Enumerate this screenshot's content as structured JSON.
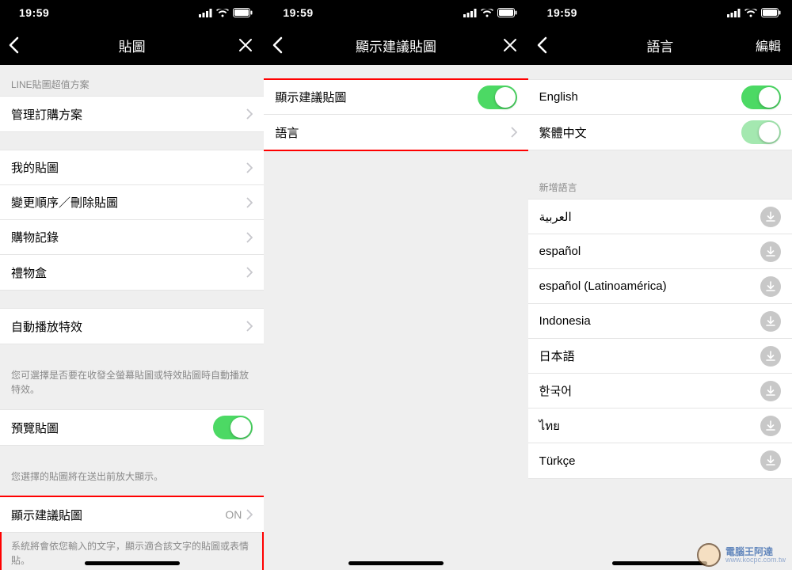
{
  "status_time": "19:59",
  "screens": [
    {
      "title": "貼圖",
      "right_action": {
        "type": "close"
      },
      "sections": [
        {
          "header": "LINE貼圖超值方案",
          "rows": [
            {
              "label": "管理訂購方案",
              "type": "link"
            }
          ]
        },
        {
          "rows": [
            {
              "label": "我的貼圖",
              "type": "link"
            },
            {
              "label": "變更順序／刪除貼圖",
              "type": "link"
            },
            {
              "label": "購物記錄",
              "type": "link"
            },
            {
              "label": "禮物盒",
              "type": "link"
            }
          ]
        },
        {
          "rows": [
            {
              "label": "自動播放特效",
              "type": "link"
            }
          ],
          "footer": "您可選擇是否要在收發全螢幕貼圖或特效貼圖時自動播放特效。"
        },
        {
          "rows": [
            {
              "label": "預覽貼圖",
              "type": "toggle",
              "on": true
            }
          ],
          "footer": "您選擇的貼圖將在送出前放大顯示。"
        },
        {
          "highlight": true,
          "rows": [
            {
              "label": "顯示建議貼圖",
              "type": "link",
              "value": "ON"
            }
          ],
          "footer": "系統將會依您輸入的文字，顯示適合該文字的貼圖或表情貼。"
        }
      ]
    },
    {
      "title": "顯示建議貼圖",
      "right_action": {
        "type": "close"
      },
      "sections": [
        {
          "highlight": true,
          "rows": [
            {
              "label": "顯示建議貼圖",
              "type": "toggle",
              "on": true
            },
            {
              "label": "語言",
              "type": "link"
            }
          ]
        }
      ]
    },
    {
      "title": "語言",
      "right_action": {
        "type": "text",
        "label": "編輯"
      },
      "sections": [
        {
          "rows": [
            {
              "label": "English",
              "type": "toggle",
              "on": true
            },
            {
              "label": "繁體中文",
              "type": "toggle",
              "on": true,
              "faded": true
            }
          ]
        },
        {
          "header": "新增語言",
          "rows": [
            {
              "label": "العربية",
              "type": "download"
            },
            {
              "label": "español",
              "type": "download"
            },
            {
              "label": "español (Latinoamérica)",
              "type": "download"
            },
            {
              "label": "Indonesia",
              "type": "download"
            },
            {
              "label": "日本語",
              "type": "download"
            },
            {
              "label": "한국어",
              "type": "download"
            },
            {
              "label": "ไทย",
              "type": "download"
            },
            {
              "label": "Türkçe",
              "type": "download"
            }
          ]
        }
      ]
    }
  ],
  "watermark": {
    "line1": "電腦王阿達",
    "line2": "www.kocpc.com.tw"
  }
}
